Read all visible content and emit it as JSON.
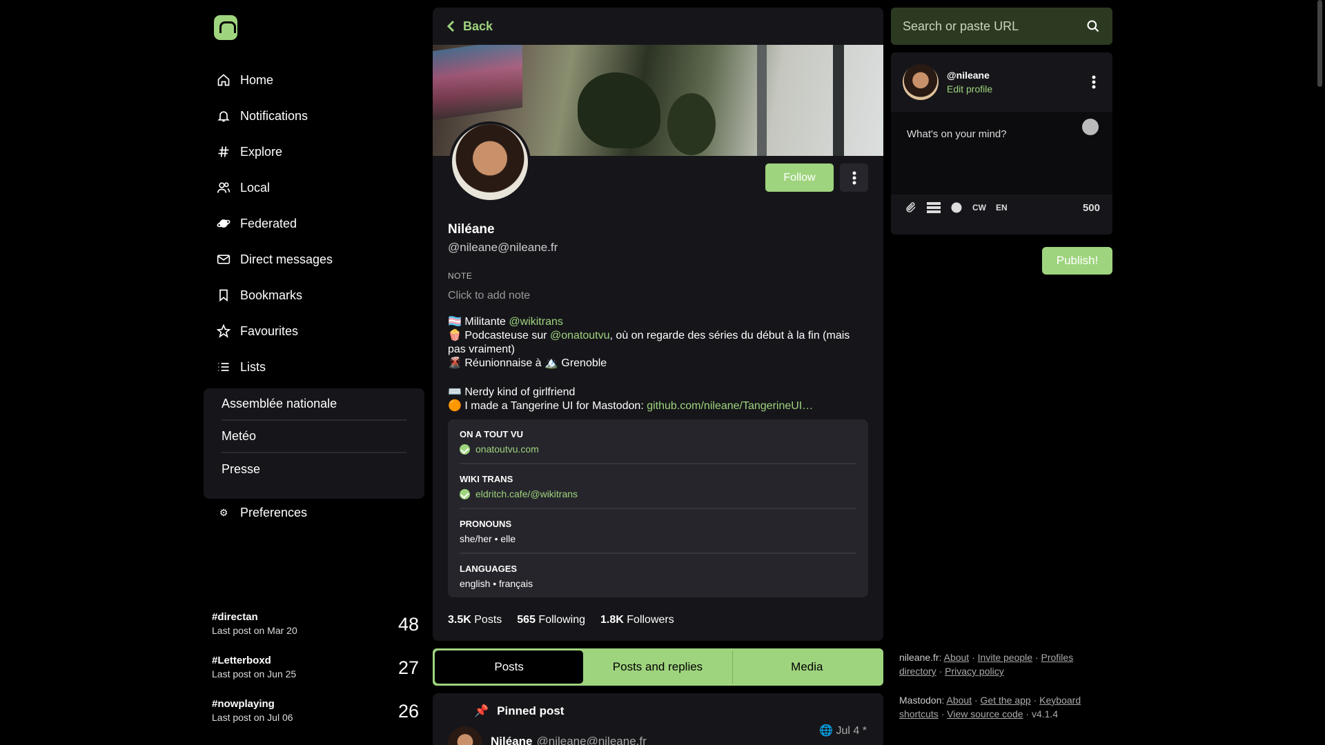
{
  "nav": {
    "items": [
      {
        "label": "Home",
        "icon": "home-icon"
      },
      {
        "label": "Notifications",
        "icon": "bell-icon"
      },
      {
        "label": "Explore",
        "icon": "hash-icon"
      },
      {
        "label": "Local",
        "icon": "users-icon"
      },
      {
        "label": "Federated",
        "icon": "globe-icon"
      },
      {
        "label": "Direct messages",
        "icon": "mail-icon"
      },
      {
        "label": "Bookmarks",
        "icon": "bookmark-icon"
      },
      {
        "label": "Favourites",
        "icon": "star-icon"
      },
      {
        "label": "Lists",
        "icon": "list-icon"
      }
    ],
    "lists": [
      "Assemblée nationale",
      "Metéo",
      "Presse"
    ],
    "preferences": "Preferences"
  },
  "trending": [
    {
      "tag": "#directan",
      "last": "Last post on Mar 20",
      "count": "48"
    },
    {
      "tag": "#Letterboxd",
      "last": "Last post on Jun 25",
      "count": "27"
    },
    {
      "tag": "#nowplaying",
      "last": "Last post on Jul 06",
      "count": "26"
    }
  ],
  "profile": {
    "back": "Back",
    "follow": "Follow",
    "name": "Niléane",
    "handle": "@nileane@nileane.fr",
    "note_label": "NOTE",
    "note_placeholder": "Click to add note",
    "bio": {
      "l1_pre": "🏳️‍⚧️ Militante ",
      "l1_link": "@wikitrans",
      "l2_pre": "🍿 Podcasteuse sur ",
      "l2_link": "@onatoutvu",
      "l2_post": ", où on regarde des séries du début à la fin (mais pas vraiment)",
      "l3": "🌋 Réunionnaise à 🏔️ Grenoble",
      "l4": "⌨️ Nerdy kind of girlfriend",
      "l5_pre": "🟠 I made a Tangerine UI for Mastodon: ",
      "l5_link": "github.com/nileane/TangerineUI…"
    },
    "fields": [
      {
        "key": "ON A TOUT VU",
        "value": "onatoutvu.com",
        "verified": true
      },
      {
        "key": "WIKI TRANS",
        "value": "eldritch.cafe/@wikitrans",
        "verified": true
      },
      {
        "key": "PRONOUNS",
        "value": "she/her • elle",
        "verified": false
      },
      {
        "key": "LANGUAGES",
        "value": "english • français",
        "verified": false
      }
    ],
    "stats": {
      "posts_n": "3.5K",
      "posts_l": "Posts",
      "following_n": "565",
      "following_l": "Following",
      "followers_n": "1.8K",
      "followers_l": "Followers"
    },
    "tabs": [
      "Posts",
      "Posts and replies",
      "Media"
    ],
    "pinned_label": "Pinned post",
    "post": {
      "name": "Niléane",
      "handle": "@nileane@nileane.fr",
      "date": "Jul 4 *"
    }
  },
  "right": {
    "search_placeholder": "Search or paste URL",
    "me_handle": "@nileane",
    "edit_profile": "Edit profile",
    "compose_placeholder": "What's on your mind?",
    "cw": "CW",
    "lang": "EN",
    "char_count": "500",
    "publish": "Publish!",
    "footer": {
      "instance": "nileane.fr",
      "links1": [
        "About",
        "Invite people",
        "Profiles directory",
        "Privacy policy"
      ],
      "mastodon": "Mastodon",
      "links2": [
        "About",
        "Get the app",
        "Keyboard shortcuts",
        "View source code"
      ],
      "version": "v4.1.4"
    }
  },
  "colors": {
    "accent": "#9fd47e",
    "panel": "#16161a",
    "background": "#000000"
  }
}
